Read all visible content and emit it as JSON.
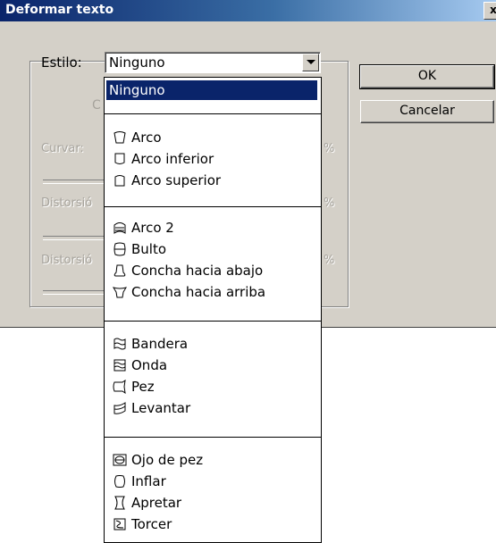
{
  "dialog": {
    "title": "Deformar texto",
    "close": "x",
    "style_label": "Estilo:",
    "style_value": "Ninguno",
    "curve_label": "Curvar:",
    "dist1_label": "Distorsió",
    "dist2_label": "Distorsió",
    "radio_fragment": "C",
    "percent": "%",
    "ok": "OK",
    "cancel": "Cancelar"
  },
  "dropdown": {
    "selected": "Ninguno",
    "groups": [
      [
        {
          "label": "Arco",
          "icon": "arc-icon"
        },
        {
          "label": "Arco inferior",
          "icon": "arc-lower-icon"
        },
        {
          "label": "Arco superior",
          "icon": "arc-upper-icon"
        }
      ],
      [
        {
          "label": "Arco 2",
          "icon": "arch-icon"
        },
        {
          "label": "Bulto",
          "icon": "bulge-icon"
        },
        {
          "label": "Concha hacia abajo",
          "icon": "shell-lower-icon"
        },
        {
          "label": "Concha hacia arriba",
          "icon": "shell-upper-icon"
        }
      ],
      [
        {
          "label": "Bandera",
          "icon": "flag-icon"
        },
        {
          "label": "Onda",
          "icon": "wave-icon"
        },
        {
          "label": "Pez",
          "icon": "fish-icon"
        },
        {
          "label": "Levantar",
          "icon": "rise-icon"
        }
      ],
      [
        {
          "label": "Ojo de pez",
          "icon": "fisheye-icon"
        },
        {
          "label": "Inflar",
          "icon": "inflate-icon"
        },
        {
          "label": "Apretar",
          "icon": "squeeze-icon"
        },
        {
          "label": "Torcer",
          "icon": "twist-icon"
        }
      ]
    ]
  }
}
